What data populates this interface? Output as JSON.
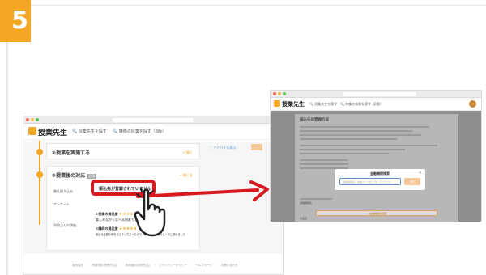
{
  "step": {
    "number": "5"
  },
  "left_browser": {
    "brand": "授業先生",
    "nav_search_teacher": "授業先生を探す",
    "nav_search_lesson": "映像の授業を探す（β版）",
    "section_implement": {
      "title": "②授業を実施する",
      "link": "+ 開く"
    },
    "section_after": {
      "title": "③授業後の対応",
      "tag": "必須",
      "link": "− 閉じる",
      "rows": [
        {
          "label": "謝礼振り込み",
          "value": "振込先が登録されていません"
        },
        {
          "label": "アンケート",
          "value": ""
        },
        {
          "label": "学校さんの評価",
          "value": ""
        }
      ],
      "reviews": [
        {
          "title": "①授業の満足度",
          "stars": "★★★★★",
          "text": "楽しみながら学べる授業でした"
        },
        {
          "title": "②講師の満足度",
          "stars": "★★★★★",
          "text": "身近な話題の例を交えてくださったので、子どもたちもスムーズに進めました"
        }
      ]
    },
    "side_link": "アドバイス表示",
    "footer": "運営会社　｜　利用規約(授業先生)　｜　利用規約(学校先生)　｜　プライバシーポリシー　｜　ヘルプページ　｜　お問い合わせ"
  },
  "right_browser": {
    "brand": "授業先生",
    "nav_search_teacher": "授業先生を探す",
    "nav_search_lesson": "映像の授業を探す（β版）",
    "panel_title": "振込先の登録方法",
    "modal": {
      "title": "金融機関検索",
      "input_placeholder": "金融機関名・金融コードを入力してください",
      "search_button": "検索",
      "close": "×"
    },
    "label_bank": "金融機関名",
    "bank_button": "+ 金融機関を検索",
    "label_branch": "支店名"
  },
  "colors": {
    "accent": "#f5a623",
    "highlight": "#d71920"
  }
}
